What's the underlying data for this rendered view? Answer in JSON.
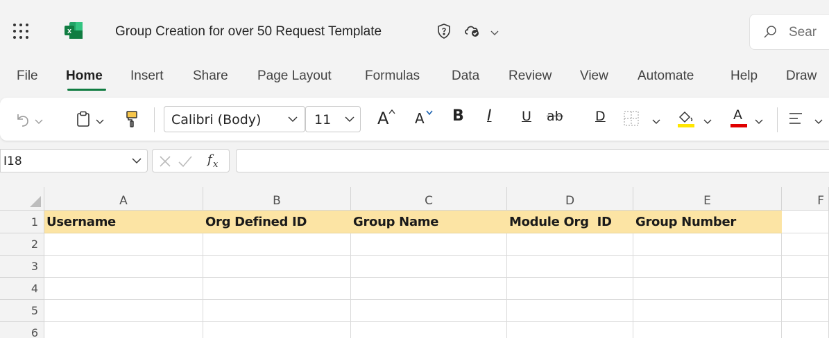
{
  "title_bar": {
    "document_title": "Group Creation for over 50 Request Template",
    "search_placeholder": "Sear",
    "app_icon": "excel-icon",
    "app_icon_letter": "x"
  },
  "tabs": [
    {
      "label": "File",
      "active": false
    },
    {
      "label": "Home",
      "active": true
    },
    {
      "label": "Insert",
      "active": false
    },
    {
      "label": "Share",
      "active": false
    },
    {
      "label": "Page Layout",
      "active": false
    },
    {
      "label": "Formulas",
      "active": false
    },
    {
      "label": "Data",
      "active": false
    },
    {
      "label": "Review",
      "active": false
    },
    {
      "label": "View",
      "active": false
    },
    {
      "label": "Automate",
      "active": false
    },
    {
      "label": "Help",
      "active": false
    },
    {
      "label": "Draw",
      "active": false
    }
  ],
  "ribbon": {
    "font_name": "Calibri (Body)",
    "font_size": "11",
    "increase_font_label": "A",
    "decrease_font_label": "A",
    "bold_label": "B",
    "italic_label": "I",
    "underline_label": "U",
    "strikethrough_label": "ab",
    "double_underline_label": "D",
    "font_color_label": "A",
    "highlight_color": "#ffe600",
    "font_color": "#e00000"
  },
  "formula_bar": {
    "name_box": "I18",
    "formula": ""
  },
  "sheet": {
    "columns": [
      "A",
      "B",
      "C",
      "D",
      "E",
      "F"
    ],
    "rows": [
      "1",
      "2",
      "3",
      "4",
      "5",
      "6"
    ],
    "header_row": [
      "Username",
      "Org Defined ID",
      "Group Name",
      "Module Org  ID",
      "Group Number"
    ],
    "header_fill": "#fce4a4"
  },
  "accent_color": "#107c41"
}
